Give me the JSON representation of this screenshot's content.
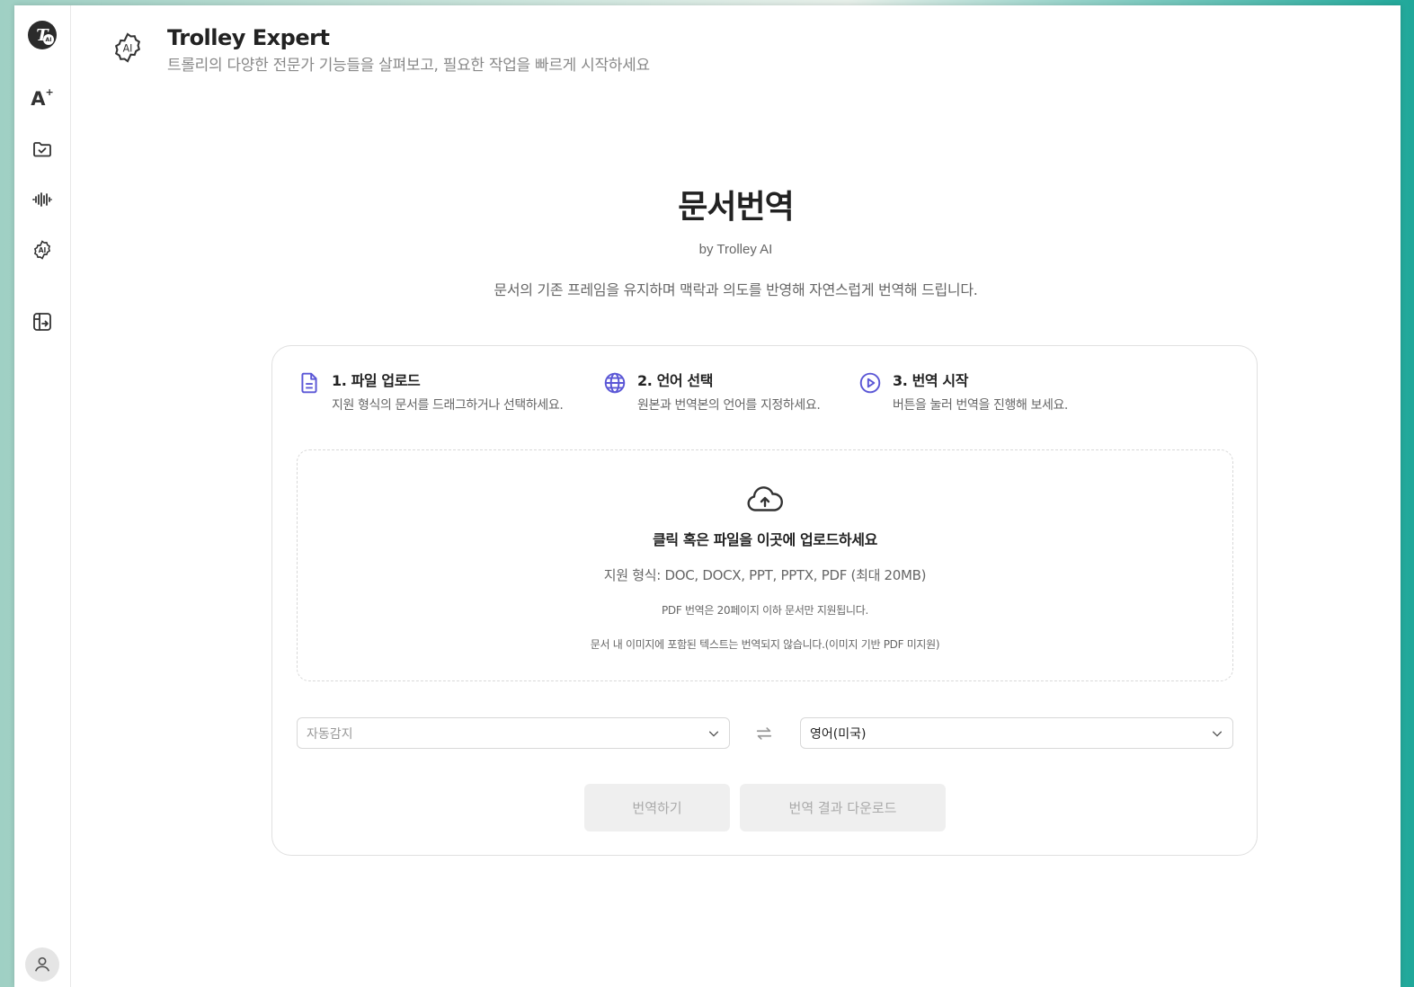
{
  "sidebar": {
    "logo_letter": "T",
    "logo_badge": "AI",
    "ai_label": "A",
    "ai_sup": "+"
  },
  "header": {
    "title": "Trolley Expert",
    "subtitle": "트롤리의 다양한 전문가 기능들을 살펴보고, 필요한 작업을 빠르게 시작하세요"
  },
  "hero": {
    "title": "문서번역",
    "by": "by Trolley AI",
    "description": "문서의 기존 프레임을 유지하며 맥락과 의도를 반영해 자연스럽게 번역해 드립니다."
  },
  "steps": [
    {
      "title": "1. 파일 업로드",
      "desc": "지원 형식의 문서를 드래그하거나 선택하세요."
    },
    {
      "title": "2. 언어 선택",
      "desc": "원본과 번역본의 언어를 지정하세요."
    },
    {
      "title": "3. 번역 시작",
      "desc": "버튼을 눌러 번역을 진행해 보세요."
    }
  ],
  "dropzone": {
    "title": "클릭 혹은 파일을 이곳에 업로드하세요",
    "formats": "지원 형식: DOC, DOCX, PPT, PPTX, PDF (최대 20MB)",
    "note1": "PDF 번역은 20페이지 이하 문서만 지원됩니다.",
    "note2": "문서 내 이미지에 포함된 텍스트는 번역되지 않습니다.(이미지 기반 PDF 미지원)"
  },
  "language": {
    "source": "자동감지",
    "target": "영어(미국)"
  },
  "buttons": {
    "translate": "번역하기",
    "download": "번역 결과 다운로드"
  },
  "colors": {
    "accent": "#5b57d6"
  },
  "icons": {
    "nav": [
      "ai-sparkle-icon",
      "folder-check-icon",
      "waveform-icon",
      "ai-badge-icon",
      "layout-arrow-icon"
    ],
    "steps": [
      "file-icon",
      "globe-icon",
      "play-circle-icon"
    ]
  }
}
